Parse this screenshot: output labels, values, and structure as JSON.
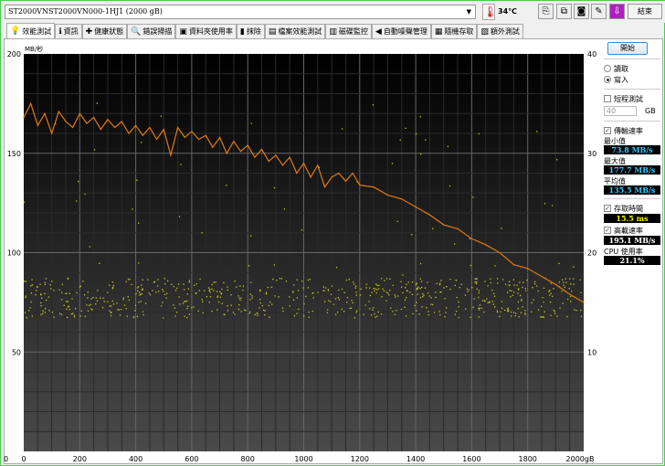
{
  "header": {
    "drive": "ST2000VNST2000VN000-1HJ1 (2000 gB)",
    "temperature": "34℃",
    "exit_label": "結束"
  },
  "tabs": [
    {
      "label": "效能測試",
      "icon": "benchmark-icon"
    },
    {
      "label": "資訊",
      "icon": "info-icon"
    },
    {
      "label": "健康狀態",
      "icon": "health-icon"
    },
    {
      "label": "錯誤掃描",
      "icon": "scan-icon"
    },
    {
      "label": "資料夾使用率",
      "icon": "folder-icon"
    },
    {
      "label": "抹除",
      "icon": "erase-icon"
    },
    {
      "label": "檔案效能測試",
      "icon": "file-benchmark-icon"
    },
    {
      "label": "磁碟監控",
      "icon": "monitor-icon"
    },
    {
      "label": "自動噪聲管理",
      "icon": "speaker-icon"
    },
    {
      "label": "隨機存取",
      "icon": "random-access-icon"
    },
    {
      "label": "額外測試",
      "icon": "extra-tests-icon"
    }
  ],
  "side": {
    "start": "開始",
    "read": "讀取",
    "write": "寫入",
    "short_stroke": "短程測試",
    "short_value": "40",
    "short_unit": "GB",
    "transfer_rate": "傳輸速率",
    "min_label": "最小值",
    "min": "73.8 MB/s",
    "max_label": "最大值",
    "max": "177.7 MB/s",
    "avg_label": "平均值",
    "avg": "135.5 MB/s",
    "access_label": "存取時間",
    "access": "15.5 ms",
    "burst_label": "高載速率",
    "burst": "195.1 MB/s",
    "cpu_label": "CPU 使用率",
    "cpu": "21.1%"
  },
  "chart_data": {
    "type": "line",
    "ylabel": "MB/秒",
    "xunit": "gB",
    "xlim": [
      0,
      2000
    ],
    "ylim": [
      0,
      200
    ],
    "y2lim": [
      0,
      40
    ],
    "xticks": [
      "0",
      "200",
      "400",
      "600",
      "800",
      "1000",
      "1200",
      "1400",
      "1600",
      "1800",
      "2000gB"
    ],
    "yticks": [
      "50",
      "100",
      "150",
      "200"
    ],
    "y2ticks": [
      "10",
      "20",
      "30",
      "40"
    ],
    "series": [
      {
        "x": [
          0,
          25,
          50,
          75,
          100,
          125,
          150,
          175,
          200,
          225,
          250,
          275,
          300,
          325,
          350,
          375,
          400,
          425,
          450,
          475,
          500,
          525,
          550,
          575,
          600,
          625,
          650,
          675,
          700,
          725,
          750,
          775,
          800,
          825,
          850,
          875,
          900,
          925,
          950,
          975,
          1000,
          1025,
          1050,
          1075,
          1100,
          1125,
          1150,
          1175,
          1200,
          1250,
          1300,
          1350,
          1400,
          1450,
          1500,
          1550,
          1600,
          1650,
          1700,
          1750,
          1800,
          1850,
          1900,
          1950,
          2000
        ],
        "y": [
          168,
          175,
          164,
          170,
          160,
          171,
          166,
          163,
          170,
          165,
          168,
          162,
          167,
          163,
          166,
          160,
          164,
          159,
          163,
          157,
          162,
          149,
          163,
          158,
          161,
          157,
          159,
          153,
          158,
          150,
          156,
          151,
          154,
          148,
          152,
          146,
          149,
          144,
          148,
          140,
          145,
          138,
          144,
          133,
          138,
          140,
          136,
          140,
          134,
          133,
          129,
          127,
          123,
          119,
          114,
          112,
          107,
          104,
          100,
          94,
          92,
          88,
          84,
          79,
          75
        ]
      }
    ],
    "access_ms": 15.5,
    "colors": {
      "transfer": "#e07a10",
      "access": "#c8c820"
    }
  }
}
